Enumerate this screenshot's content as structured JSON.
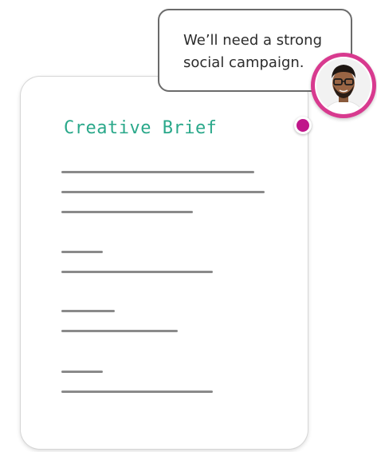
{
  "document": {
    "title": "Creative Brief",
    "title_color": "#2aa88a"
  },
  "comment": {
    "line1": "We’ll need a strong",
    "line2": "social campaign.",
    "author_avatar": "person-avatar",
    "accent_color": "#d83a8f"
  }
}
